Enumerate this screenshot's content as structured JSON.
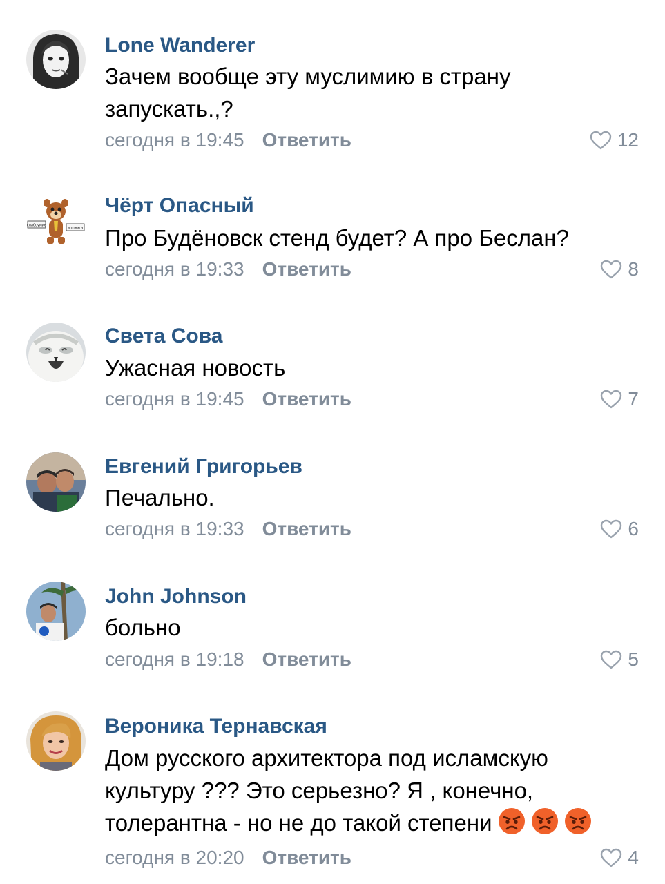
{
  "comments": [
    {
      "author": "Lone Wanderer",
      "text": "Зачем вообще эту муслимию в страну запускать.,?",
      "time": "сегодня в 19:45",
      "reply_label": "Ответить",
      "likes": "12"
    },
    {
      "author": "Чёрт Опасный",
      "text": "Про Будёновск стенд будет? А про Беслан?",
      "time": "сегодня в 19:33",
      "reply_label": "Ответить",
      "likes": "8",
      "avatar_text_left": "слабоумие",
      "avatar_text_right": "и отвага"
    },
    {
      "author": "Света Сова",
      "text": "Ужасная новость",
      "time": "сегодня в 19:45",
      "reply_label": "Ответить",
      "likes": "7"
    },
    {
      "author": "Евгений Григорьев",
      "text": "Печально.",
      "time": "сегодня в 19:33",
      "reply_label": "Ответить",
      "likes": "6"
    },
    {
      "author": "John Johnson",
      "text": "больно",
      "time": "сегодня в 19:18",
      "reply_label": "Ответить",
      "likes": "5"
    },
    {
      "author": "Вероника Тернавская",
      "text": "Дом русского архитектора под исламскую культуру ??? Это серьезно? Я , конечно, толерантна - но не до такой степени",
      "emojis": [
        "angry-face",
        "angry-face",
        "angry-face"
      ],
      "time": "сегодня в 20:20",
      "reply_label": "Ответить",
      "likes": "4"
    }
  ],
  "colors": {
    "author": "#2a5885",
    "meta": "#818c99",
    "text": "#000000",
    "emoji": "#f0612a"
  },
  "icons": {
    "like": "heart-outline-icon",
    "emoji": "angry-face-icon"
  }
}
